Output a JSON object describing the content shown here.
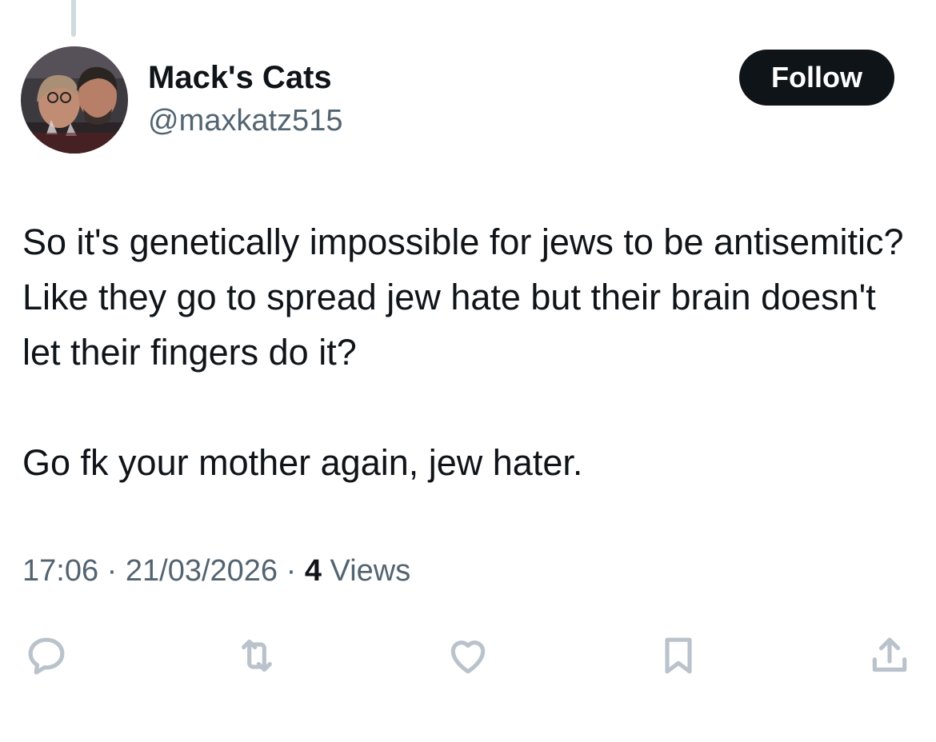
{
  "tweet": {
    "author": {
      "display_name": "Mack's Cats",
      "handle": "@maxkatz515",
      "avatar_icon": "profile-photo"
    },
    "follow_label": "Follow",
    "paragraphs": [
      "So it's genetically impossible for jews to be antisemitic? Like they go to spread jew hate but their brain doesn't let their fingers do it?",
      "Go fk your mother again, jew hater."
    ],
    "time": "17:06",
    "separator": "·",
    "date": "21/03/2026",
    "views_count": "4",
    "views_label": "Views"
  },
  "actions": [
    {
      "icon": "reply-icon"
    },
    {
      "icon": "retweet-icon"
    },
    {
      "icon": "like-icon"
    },
    {
      "icon": "bookmark-icon"
    },
    {
      "icon": "share-icon"
    }
  ],
  "colors": {
    "text_primary": "#0f1419",
    "text_secondary": "#536471",
    "icon_muted": "#bac3cb",
    "button_bg": "#0f1419",
    "button_text": "#ffffff",
    "thread_line": "#cfd9de"
  }
}
